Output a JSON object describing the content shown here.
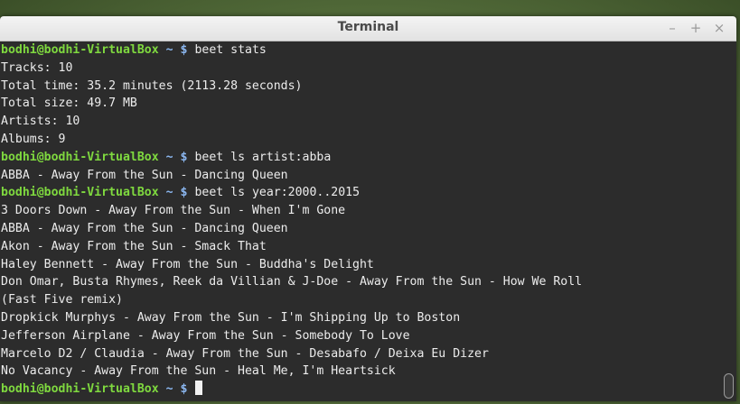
{
  "window": {
    "title": "Terminal",
    "controls": {
      "minimize": "–",
      "maximize": "+",
      "close": "×"
    }
  },
  "prompt": {
    "user": "bodhi@bodhi-VirtualBox",
    "tilde": "~",
    "dollar": "$"
  },
  "lines": [
    {
      "type": "prompt",
      "command": "beet stats"
    },
    {
      "type": "output",
      "text": "Tracks: 10"
    },
    {
      "type": "output",
      "text": "Total time: 35.2 minutes (2113.28 seconds)"
    },
    {
      "type": "output",
      "text": "Total size: 49.7 MB"
    },
    {
      "type": "output",
      "text": "Artists: 10"
    },
    {
      "type": "output",
      "text": "Albums: 9"
    },
    {
      "type": "prompt",
      "command": "beet ls artist:abba"
    },
    {
      "type": "output",
      "text": "ABBA - Away From the Sun - Dancing Queen"
    },
    {
      "type": "prompt",
      "command": "beet ls year:2000..2015"
    },
    {
      "type": "output",
      "text": "3 Doors Down - Away From the Sun - When I'm Gone"
    },
    {
      "type": "output",
      "text": "ABBA - Away From the Sun - Dancing Queen"
    },
    {
      "type": "output",
      "text": "Akon - Away From the Sun - Smack That"
    },
    {
      "type": "output",
      "text": "Haley Bennett - Away From the Sun - Buddha's Delight"
    },
    {
      "type": "output",
      "text": "Don Omar, Busta Rhymes, Reek da Villian & J-Doe - Away From the Sun - How We Roll"
    },
    {
      "type": "output",
      "text": "(Fast Five remix)"
    },
    {
      "type": "output",
      "text": "Dropkick Murphys - Away From the Sun - I'm Shipping Up to Boston"
    },
    {
      "type": "output",
      "text": "Jefferson Airplane - Away From the Sun - Somebody To Love"
    },
    {
      "type": "output",
      "text": "Marcelo D2 / Claudia - Away From the Sun - Desabafo / Deixa Eu Dizer"
    },
    {
      "type": "output",
      "text": "No Vacancy - Away From the Sun - Heal Me, I'm Heartsick"
    },
    {
      "type": "prompt",
      "command": "",
      "cursor": true
    }
  ],
  "colors": {
    "prompt_user": "#7fd93f",
    "prompt_path": "#8bb7f0",
    "text": "#ececec",
    "background": "#2c2c2c"
  }
}
